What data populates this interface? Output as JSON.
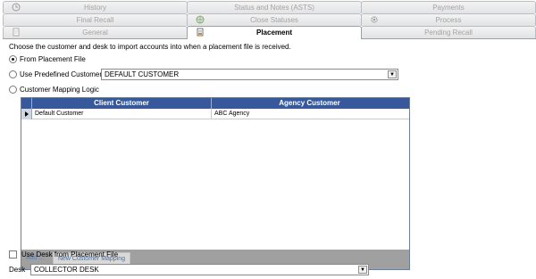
{
  "tabs": {
    "row1": [
      {
        "label": "History",
        "icon": "history-icon"
      },
      {
        "label": "Status and Notes (ASTS)",
        "icon": ""
      },
      {
        "label": "Payments",
        "icon": ""
      }
    ],
    "row2": [
      {
        "label": "Final Recall",
        "icon": ""
      },
      {
        "label": "Close Statuses",
        "icon": "globe-icon"
      },
      {
        "label": "Process",
        "icon": "gear-icon"
      }
    ],
    "row3": [
      {
        "label": "General",
        "icon": "document-icon"
      },
      {
        "label": "Placement",
        "icon": "placement-icon",
        "active": true
      },
      {
        "label": "Pending Recall",
        "icon": ""
      }
    ]
  },
  "placement": {
    "instruction": "Choose the customer and desk to import accounts into when a placement file is received.",
    "options": {
      "from_placement_file": {
        "label": "From Placement File",
        "selected": true
      },
      "predefined_customer": {
        "label": "Use Predefined Customer",
        "selected": false
      },
      "customer_mapping": {
        "label": "Customer Mapping Logic",
        "selected": false
      }
    },
    "predefined_customer_value": "DEFAULT CUSTOMER",
    "mapping_grid": {
      "columns": [
        "Client Customer",
        "Agency Customer"
      ],
      "rows": [
        {
          "client": "Default Customer",
          "agency": "ABC Agency"
        }
      ],
      "add_label": "Add ...",
      "new_mapping_label": "New Customer Mapping"
    },
    "use_desk_checkbox": {
      "label": "Use Desk from Placement File",
      "checked": false
    },
    "desk_label": "Desk",
    "desk_value": "COLLECTOR DESK"
  },
  "colors": {
    "grid_header": "#37599b",
    "grid_footer": "#a0a0a0",
    "tab_inactive_text": "#a3a3a3"
  }
}
